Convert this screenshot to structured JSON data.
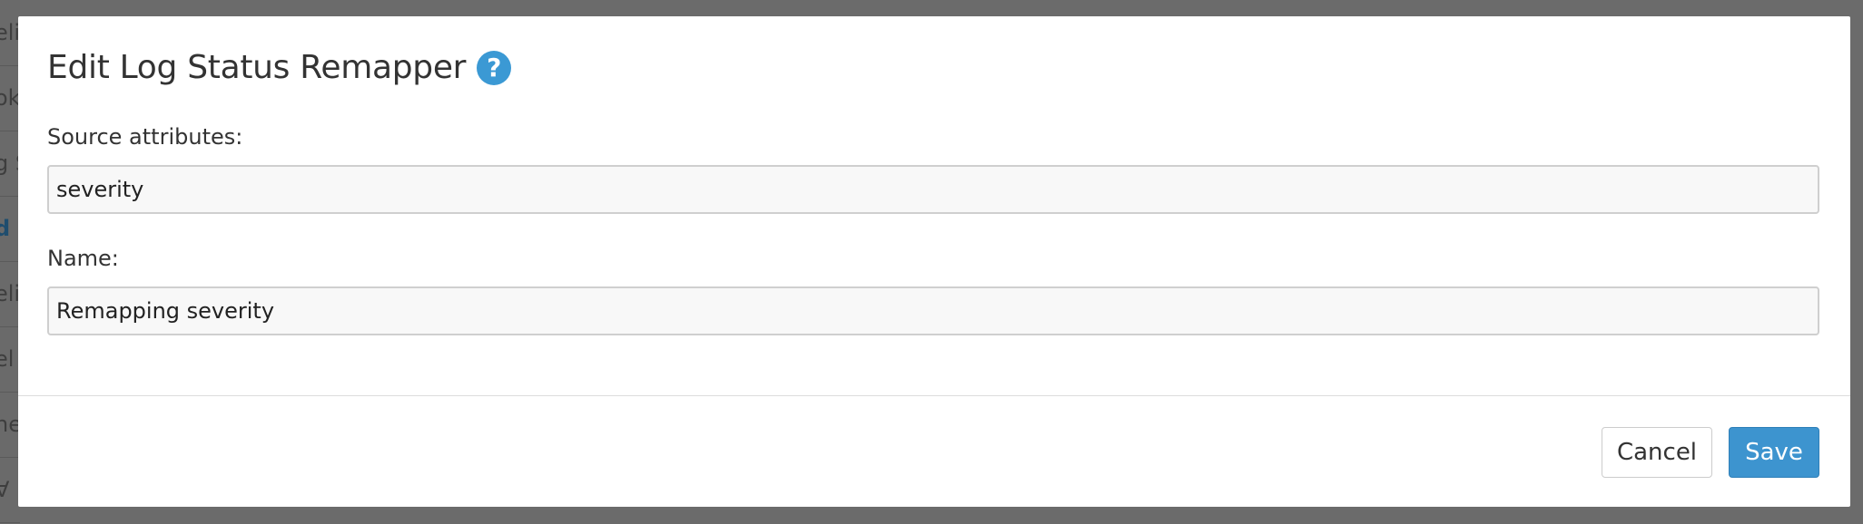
{
  "background_rows": [
    "eli",
    "ok",
    "g S",
    "d",
    "eli",
    "el",
    "he",
    "Ɐ"
  ],
  "dialog": {
    "title": "Edit Log Status Remapper",
    "help_icon": "question-mark-circle-icon",
    "fields": {
      "source_attributes": {
        "label": "Source attributes:",
        "value": "severity"
      },
      "name": {
        "label": "Name:",
        "value": "Remapping severity"
      }
    },
    "buttons": {
      "cancel_label": "Cancel",
      "save_label": "Save"
    }
  },
  "colors": {
    "overlay": "#6b6b6b",
    "accent": "#3d94cf",
    "text": "#333333"
  }
}
